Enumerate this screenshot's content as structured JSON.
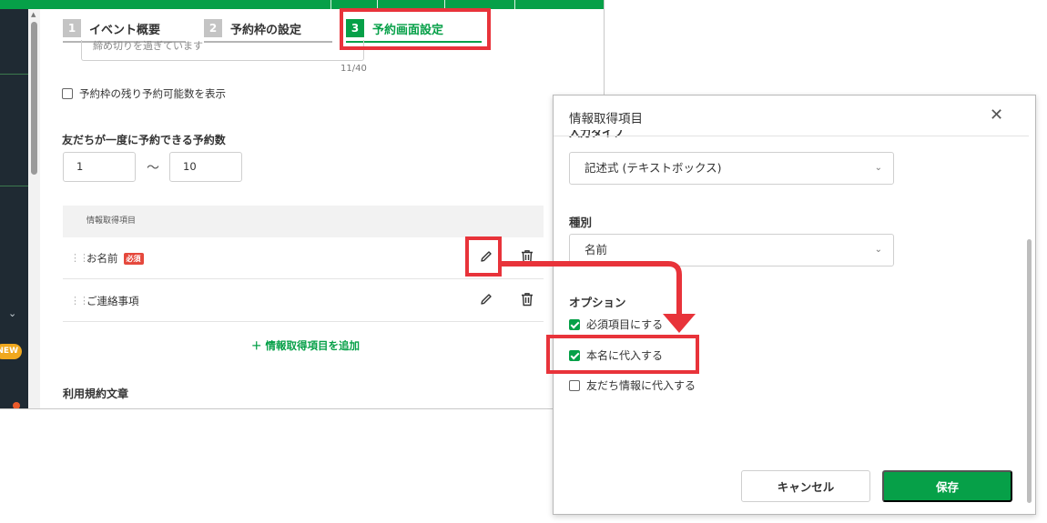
{
  "steps": [
    {
      "num": "1",
      "label": "イベント概要"
    },
    {
      "num": "2",
      "label": "予約枠の設定"
    },
    {
      "num": "3",
      "label": "予約画面設定"
    }
  ],
  "nav": {
    "badge_new": "NEW"
  },
  "text_field": {
    "value": "締め切りを過ぎています",
    "count": "11/40"
  },
  "show_remaining_label": "予約枠の残り予約可能数を表示",
  "limit": {
    "label": "友だちが一度に予約できる予約数",
    "min": "1",
    "separator": "〜",
    "max": "10"
  },
  "info_table": {
    "header": "情報取得項目",
    "rows": [
      {
        "name": "お名前",
        "badge": "必須"
      },
      {
        "name": "ご連絡事項",
        "badge": ""
      }
    ],
    "add_label": "＋ 情報取得項目を追加"
  },
  "terms_label": "利用規約文章",
  "modal": {
    "title": "情報取得項目",
    "close": "✕",
    "cut_label": "入力タイプ",
    "input_type": "記述式 (テキストボックス)",
    "kind_label": "種別",
    "kind_value": "名前",
    "options_label": "オプション",
    "options": [
      {
        "label": "必須項目にする",
        "checked": true
      },
      {
        "label": "本名に代入する",
        "checked": true
      },
      {
        "label": "友だち情報に代入する",
        "checked": false
      }
    ],
    "cancel": "キャンセル",
    "save": "保存"
  },
  "colors": {
    "brand_green": "#06a048",
    "annotation_red": "#e8333a",
    "badge_red": "#e5483c"
  },
  "icons": [
    "pencil-icon",
    "trash-icon",
    "grip-icon",
    "chevron-down-icon",
    "close-icon",
    "check-icon"
  ]
}
